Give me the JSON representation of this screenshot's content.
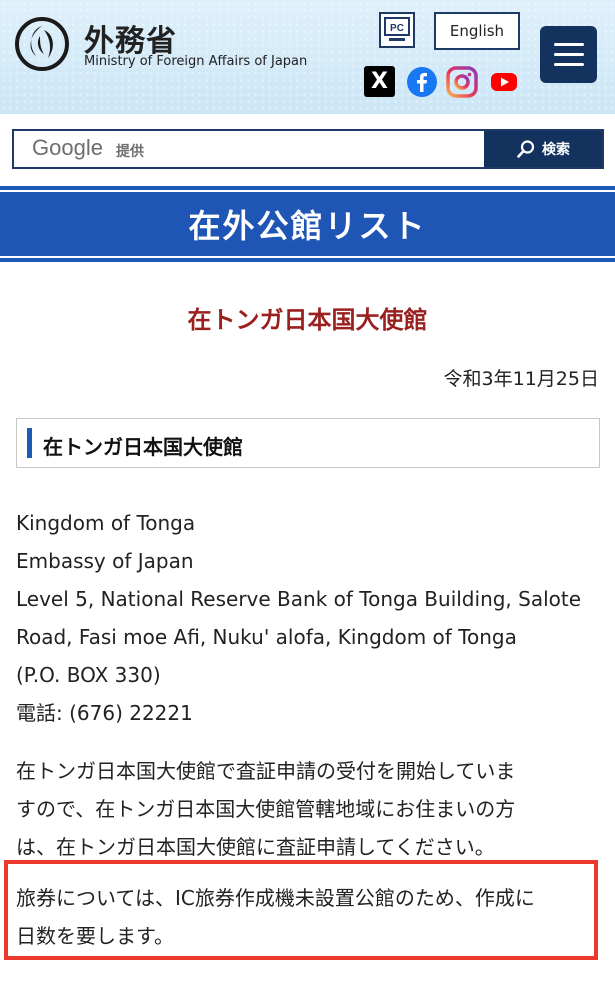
{
  "header": {
    "ministry_name_ja": "外務省",
    "ministry_name_en": "Ministry of Foreign Affairs of Japan",
    "pc_label": "PC",
    "english_label": "English",
    "social": [
      {
        "icon": "x-icon",
        "glyph": "X"
      },
      {
        "icon": "facebook-icon"
      },
      {
        "icon": "instagram-icon"
      },
      {
        "icon": "youtube-icon"
      }
    ],
    "menu_icon": "hamburger-menu-icon"
  },
  "search": {
    "provider": "Google",
    "provided_label": "提供",
    "button_label": "検索",
    "placeholder": ""
  },
  "banner": {
    "title": "在外公館リスト"
  },
  "page": {
    "title": "在トンガ日本国大使館",
    "date": "令和3年11月25日",
    "section_title": "在トンガ日本国大使館",
    "address_lines": [
      "Kingdom of Tonga",
      "Embassy of Japan",
      "Level 5, National Reserve Bank of Tonga Building, Salote",
      "Road, Fasi moe Afi, Nuku' alofa, Kingdom of Tonga",
      "(P.O. BOX 330)",
      "電話: (676) 22221"
    ],
    "notice_lines": [
      "在トンガ日本国大使館で査証申請の受付を開始していま",
      "すので、在トンガ日本国大使館管轄地域にお住まいの方",
      "は、在トンガ日本国大使館に査証申請してください。"
    ],
    "passport_note_lines": [
      "旅券については、IC旅券作成機未設置公館のため、作成に",
      "日数を要します。"
    ]
  },
  "colors": {
    "brand_navy": "#13335e",
    "banner_blue": "#1f56b5",
    "title_red": "#9a1f1f",
    "highlight_red": "#ea3a2e"
  }
}
